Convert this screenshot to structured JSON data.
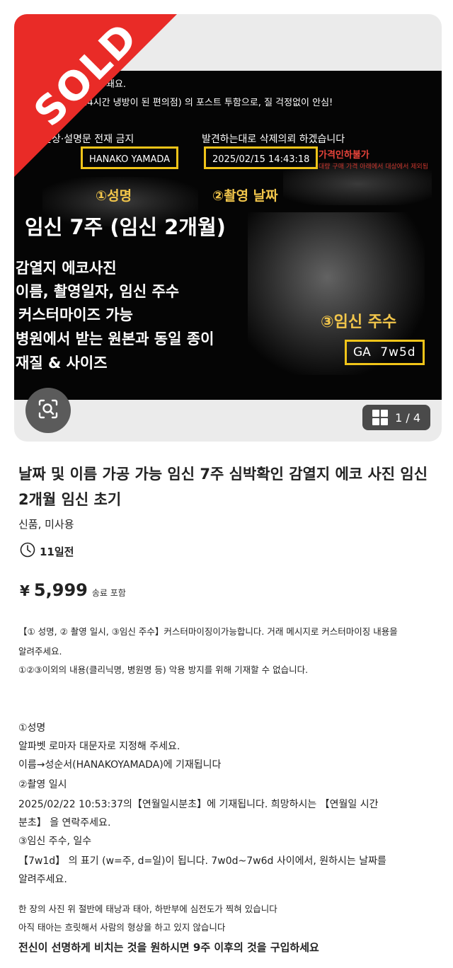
{
  "listing_image": {
    "sold_label": "SOLD",
    "overlay_lines": {
      "line1": "변질이 돼요.",
      "line2": "(24시간 냉방이 된 편의점) 의 포스트 투함으로, 질 걱정없이 안심!",
      "ban_notice": "면상·설명문 전재 금지",
      "delete_notice": "발견하는대로 삭제의뢰 하겠습니다",
      "name_box": "HANAKO YAMADA",
      "date_box": "2025/02/15 14:43:18",
      "no_discount": "가격인하불가",
      "no_discount_sub": "대량 구매 가격 아래에서 대상에서 제외됨",
      "label1": "①성명",
      "label2": "②촬영 날짜",
      "headline": "임신 7주 (임신 2개월)",
      "features": [
        "감열지 에코사진",
        "이름, 촬영일자, 임신 주수",
        "커스터마이즈 가능",
        "병원에서 받는 원본과 동일 종이",
        "재질 & 사이즈"
      ],
      "label3": "③임신 주수",
      "ga_prefix": "GA",
      "ga_value": "7w5d"
    },
    "counter": "1 / 4"
  },
  "item": {
    "title": "날짜 및 이름 가공 가능 임신 7주 심박확인 감열지 에코 사진 임신 2개월 임신 초기",
    "condition": "신품, 미사용",
    "posted": "11일전",
    "price_symbol": "¥",
    "price": "5,999",
    "shipping": "송료 포함"
  },
  "description": {
    "p1_l1": "【① 성명, ② 촬영 일시, ③임신 주수】커스터마이징이가능합니다. 거래 메시지로 커스터마이징 내용을",
    "p1_l2": "알려주세요.",
    "p1_l3": "①②③이외의 내용(클리닉명, 병원명 등) 악용 방지를 위해 기재할 수 없습니다.",
    "s1_head": "①성명",
    "s1_l1": "알파벳 로마자 대문자로 지정해 주세요.",
    "s1_l2": "이름→성순서(HANAKOYAMADA)에 기재됩니다",
    "s2_head": "②촬영 일시",
    "s2_l1": "2025/02/22 10:53:37의【연월일시분초】에 기재됩니다. 희망하시는 【연월일 시간",
    "s2_l2": "분초】 을 연락주세요.",
    "s3_head": "③임신 주수, 일수",
    "s3_l1": "【7w1d】 의 표기 (w=주, d=일)이 됩니다. 7w0d~7w6d 사이에서, 원하시는 날짜를",
    "s3_l2": "알려주세요.",
    "n1": "한 장의 사진 위 절반에 태낭과 태아, 하반부에 심전도가 찍혀 있습니다",
    "n2": "아직 태아는 흐릿해서 사람의 형상을 하고 있지 않습니다",
    "n3": "전신이 선명하게 비치는 것을 원하시면 9주 이후의 것을 구입하세요"
  }
}
